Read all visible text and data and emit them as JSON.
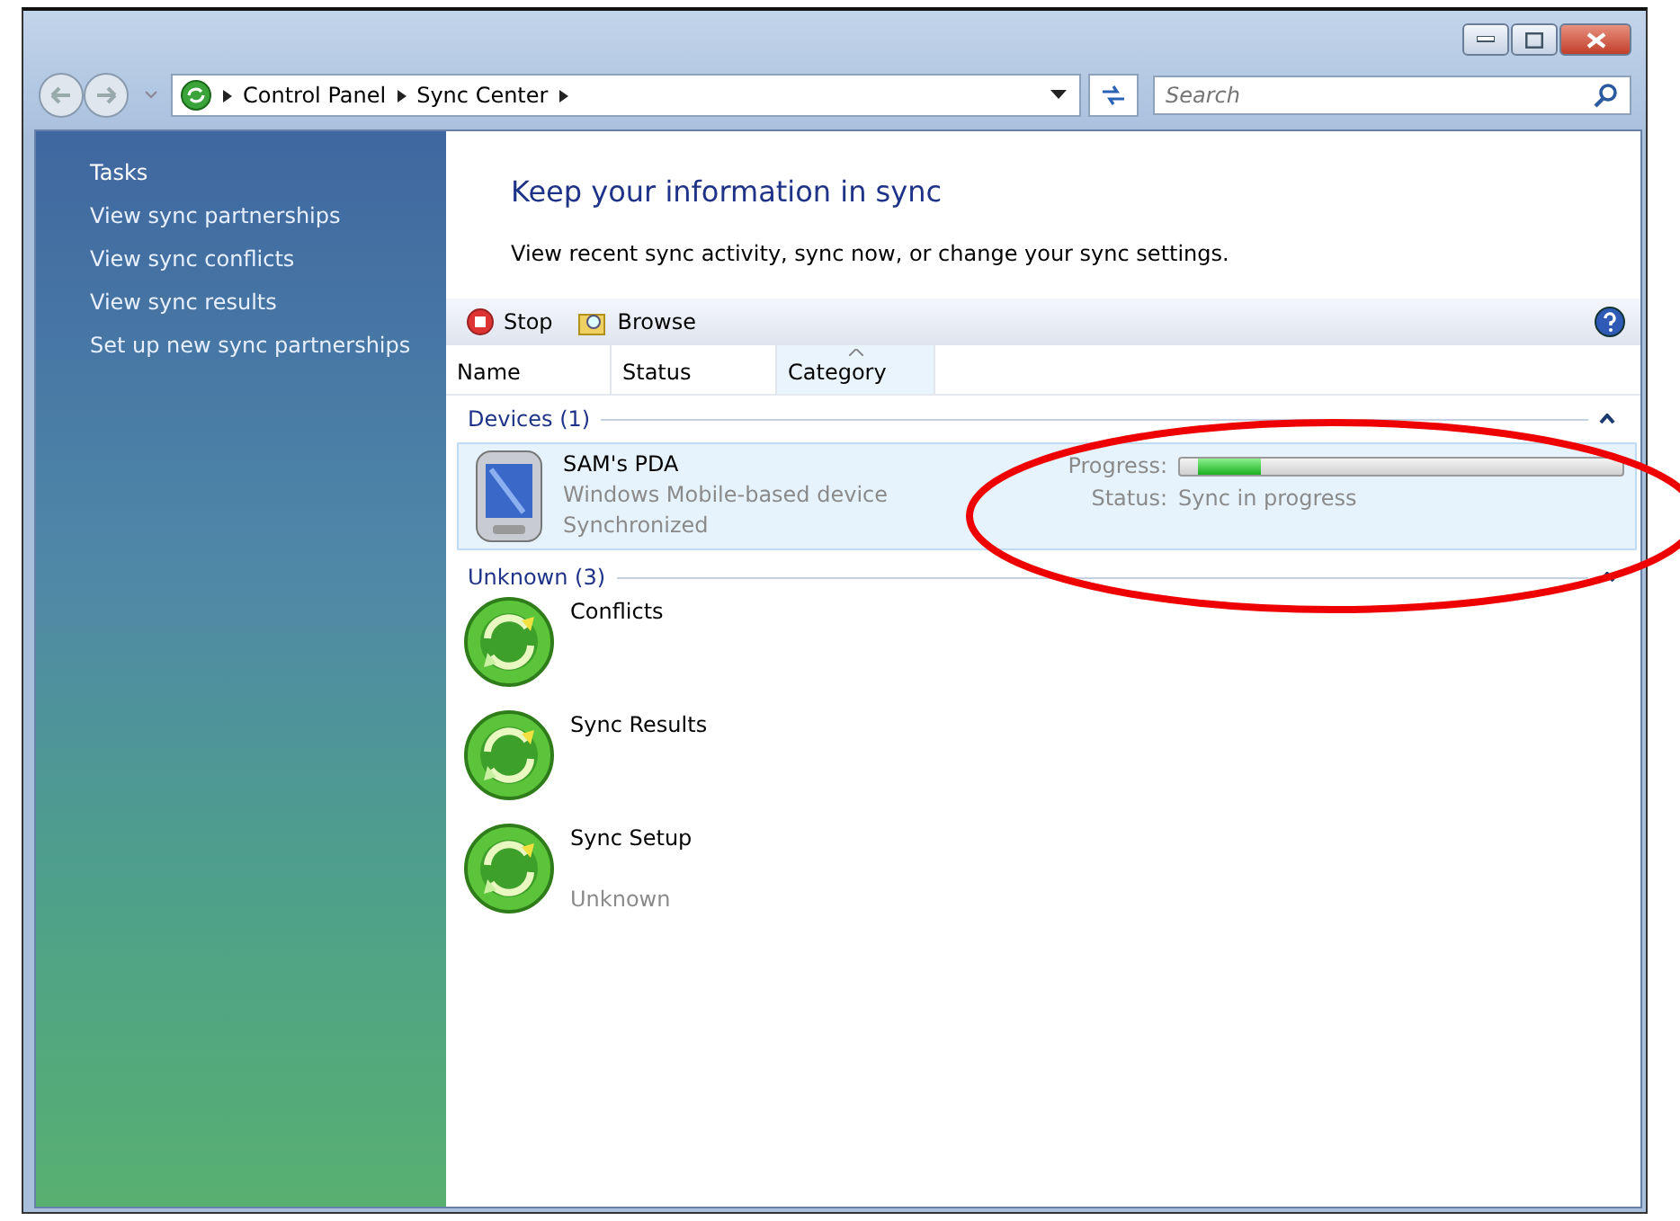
{
  "address_bar": {
    "breadcrumbs": [
      "Control Panel",
      "Sync Center"
    ]
  },
  "search": {
    "placeholder": "Search"
  },
  "sidebar": {
    "heading": "Tasks",
    "items": [
      "View sync partnerships",
      "View sync conflicts",
      "View sync results",
      "Set up new sync partnerships"
    ]
  },
  "content": {
    "title": "Keep your information in sync",
    "description": "View recent sync activity, sync now, or change your sync settings."
  },
  "toolbar": {
    "buttons": [
      {
        "kind": "stop",
        "label": "Stop"
      },
      {
        "kind": "browse",
        "label": "Browse"
      }
    ]
  },
  "columns": [
    {
      "label": "Name",
      "sorted": false
    },
    {
      "label": "Status",
      "sorted": false
    },
    {
      "label": "Category",
      "sorted": true
    }
  ],
  "groups": [
    {
      "title": "Devices (1)",
      "expanded": true,
      "items": [
        {
          "kind": "device",
          "name": "SAM's PDA",
          "details": [
            "Windows Mobile-based device",
            "Synchronized"
          ],
          "selected": true,
          "progress_label": "Progress:",
          "level": 0.15,
          "status_label": "Status:",
          "status": "Sync in progress"
        }
      ]
    },
    {
      "title": "Unknown (3)",
      "expanded": true,
      "items": [
        {
          "kind": "sync",
          "name": "Conflicts",
          "selected": false
        },
        {
          "kind": "sync",
          "name": "Sync Results",
          "selected": false
        },
        {
          "kind": "sync",
          "name": "Sync Setup",
          "details": [
            "Unknown"
          ],
          "selected": false
        }
      ]
    }
  ]
}
